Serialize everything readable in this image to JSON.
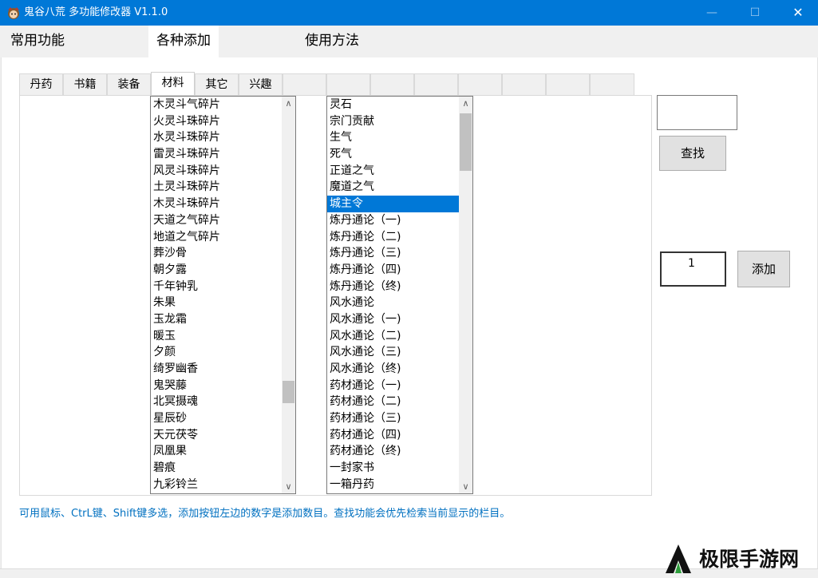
{
  "window": {
    "title": "鬼谷八荒 多功能修改器 V1.1.0",
    "min_glyph": "—",
    "max_glyph": "☐",
    "close_glyph": "✕"
  },
  "main_tabs": [
    "常用功能",
    "各种添加",
    "使用方法"
  ],
  "sub_tabs": [
    "丹药",
    "书籍",
    "装备",
    "材料",
    "其它",
    "兴趣"
  ],
  "list_left": {
    "items": [
      "木灵斗气碎片",
      "火灵斗珠碎片",
      "水灵斗珠碎片",
      "雷灵斗珠碎片",
      "风灵斗珠碎片",
      "土灵斗珠碎片",
      "木灵斗珠碎片",
      "天道之气碎片",
      "地道之气碎片",
      "葬沙骨",
      "朝夕露",
      "千年钟乳",
      "朱果",
      "玉龙霜",
      "暖玉",
      "夕颜",
      "绮罗幽香",
      "鬼哭藤",
      "北冥摄魂",
      "星辰砂",
      "天元茯苓",
      "凤凰果",
      "碧痕",
      "九彩铃兰"
    ]
  },
  "list_right": {
    "items": [
      "灵石",
      "宗门贡献",
      "生气",
      "死气",
      "正道之气",
      "魔道之气",
      "城主令",
      "炼丹通论（一)",
      "炼丹通论（二)",
      "炼丹通论（三)",
      "炼丹通论（四)",
      "炼丹通论（终)",
      "风水通论",
      "风水通论（一)",
      "风水通论（二)",
      "风水通论（三)",
      "风水通论（终)",
      "药材通论（一)",
      "药材通论（二)",
      "药材通论（三)",
      "药材通论（四)",
      "药材通论（终)",
      "一封家书",
      "一箱丹药"
    ],
    "selected": "城主令"
  },
  "search": {
    "value": "",
    "button": "查找"
  },
  "add": {
    "count": "1",
    "button": "添加"
  },
  "hint": "可用鼠标、CtrL键、Shift键多选，添加按钮左边的数字是添加数目。查找功能会优先检索当前显示的栏目。",
  "watermark": {
    "text": "极限手游网"
  },
  "colors": {
    "titlebar": "#0078d7",
    "selection": "#0078d7",
    "hint": "#0070c0"
  }
}
